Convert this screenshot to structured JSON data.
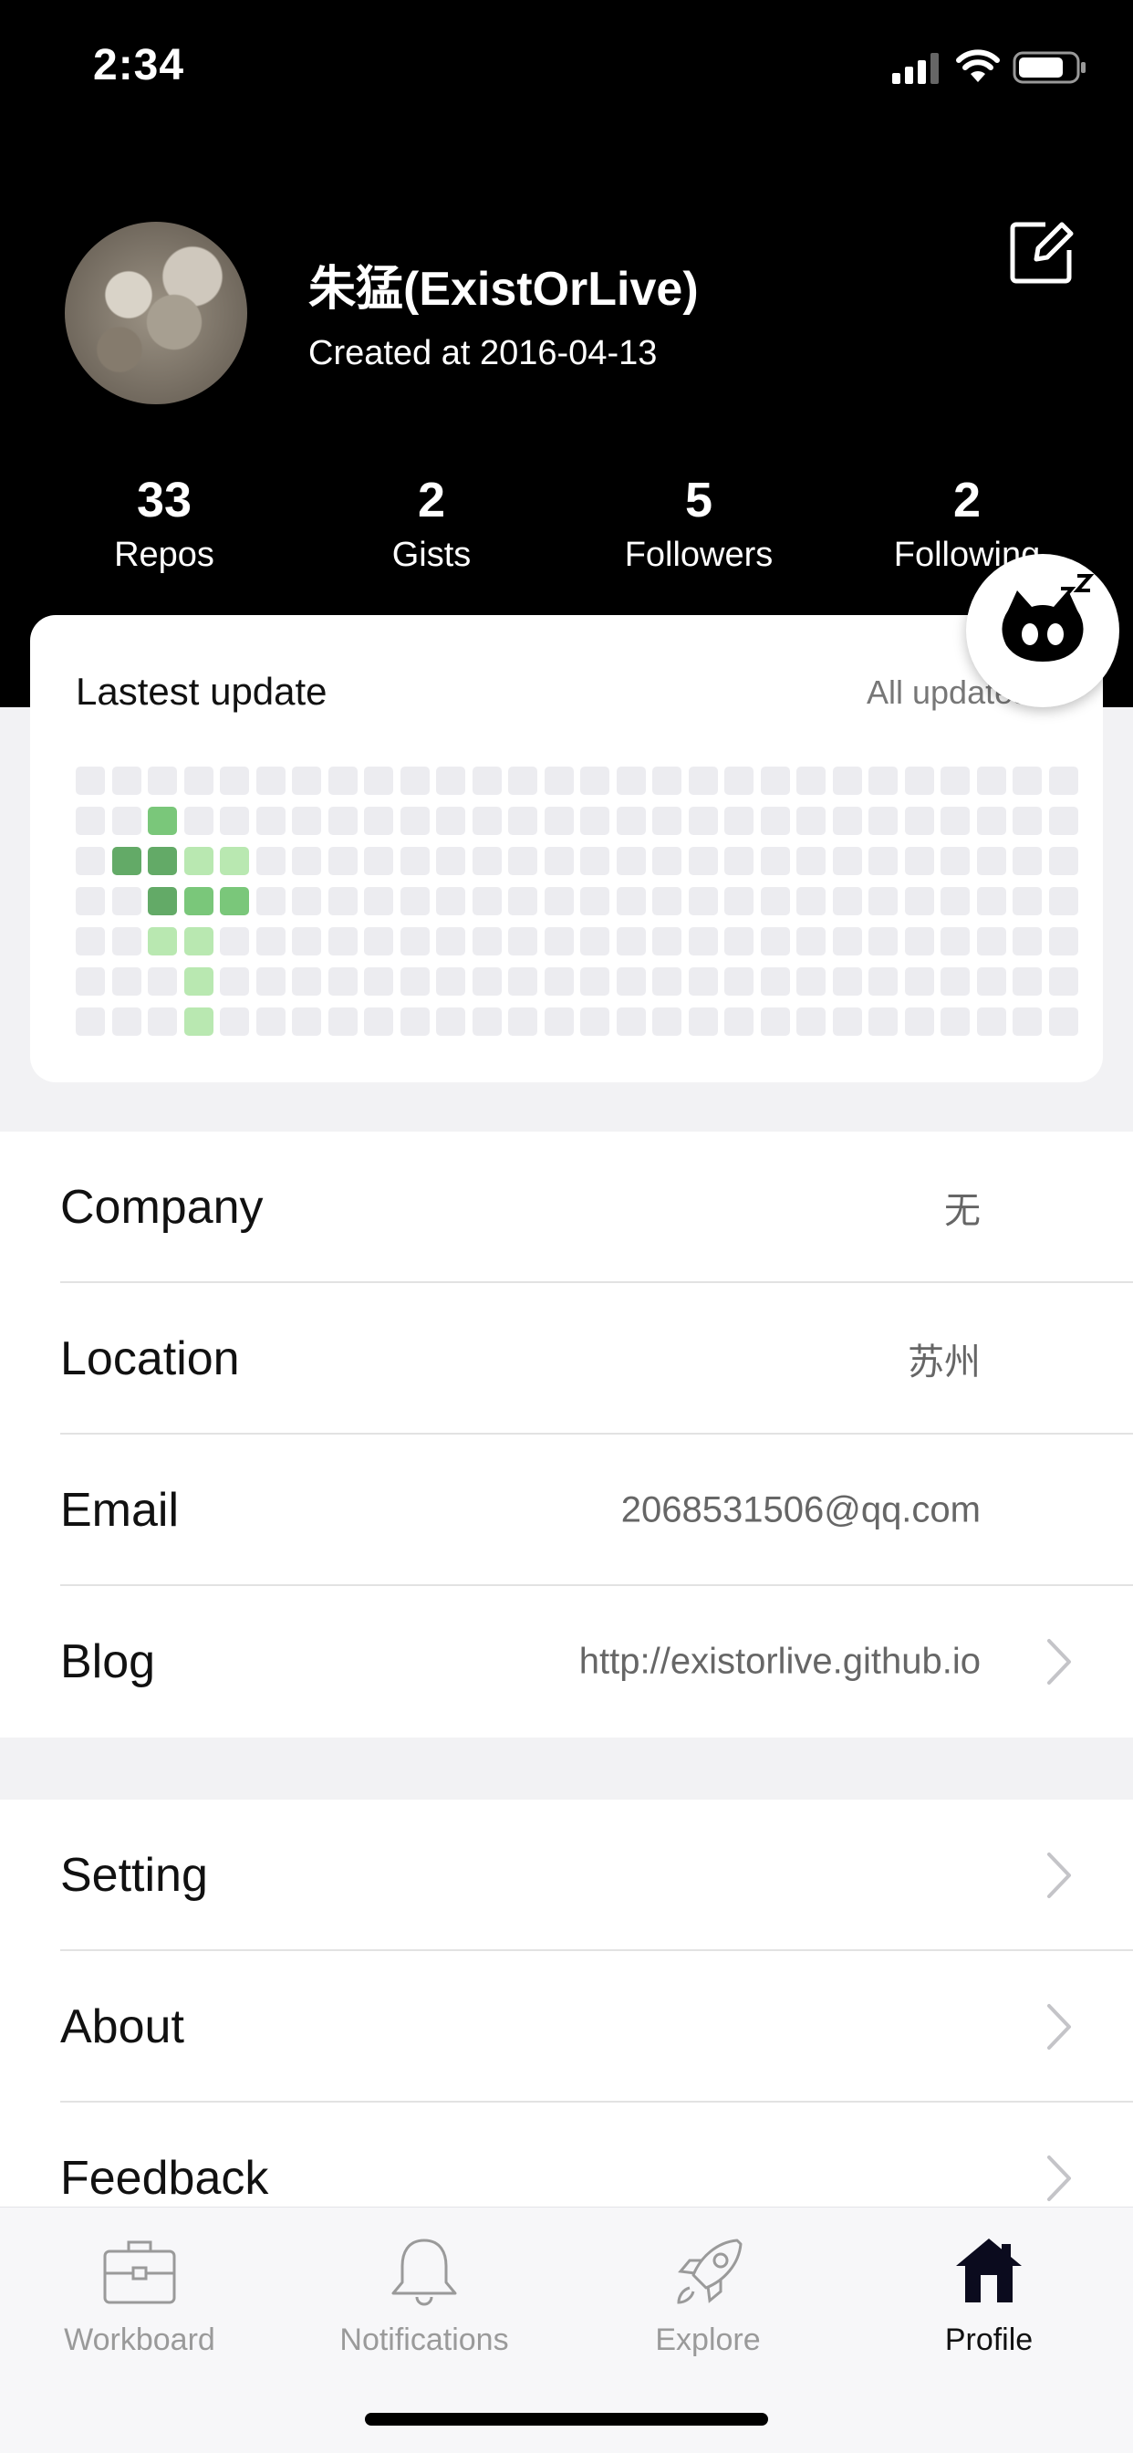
{
  "status_bar": {
    "time": "2:34"
  },
  "profile": {
    "name": "朱猛(ExistOrLive)",
    "created": "Created at 2016-04-13",
    "stats": [
      {
        "value": "33",
        "label": "Repos"
      },
      {
        "value": "2",
        "label": "Gists"
      },
      {
        "value": "5",
        "label": "Followers"
      },
      {
        "value": "2",
        "label": "Following"
      }
    ]
  },
  "contributions": {
    "title": "Lastest update",
    "link": "All updates",
    "weeks": 28,
    "colors": [
      "#ececf0",
      "#b9e8b1",
      "#7ac77a",
      "#63aa67",
      "#4c8756"
    ],
    "levels": [
      "0000000000000000000000000000",
      "0020000000000000000000000000",
      "0331100000000000000000000000",
      "0032200000000000000000000000",
      "0011000000000000000000000000",
      "0001000000000000000000000000",
      "0001000000000000000000000000"
    ]
  },
  "info_list": [
    {
      "label": "Company",
      "value": "无"
    },
    {
      "label": "Location",
      "value": "苏州"
    },
    {
      "label": "Email",
      "value": "2068531506@qq.com"
    },
    {
      "label": "Blog",
      "value": "http://existorlive.github.io"
    }
  ],
  "settings_list": [
    {
      "label": "Setting"
    },
    {
      "label": "About"
    },
    {
      "label": "Feedback"
    }
  ],
  "tabs": [
    {
      "label": "Workboard",
      "icon": "briefcase-icon"
    },
    {
      "label": "Notifications",
      "icon": "bell-icon"
    },
    {
      "label": "Explore",
      "icon": "rocket-icon"
    },
    {
      "label": "Profile",
      "icon": "home-icon"
    }
  ]
}
